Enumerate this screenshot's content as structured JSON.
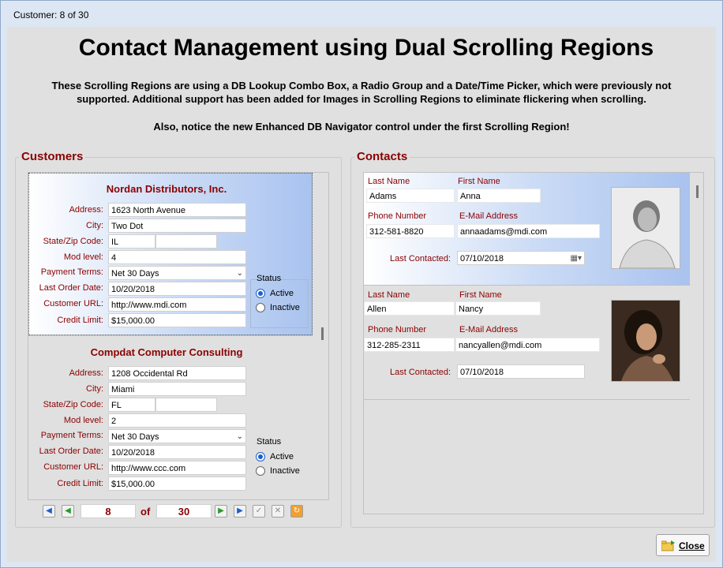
{
  "window": {
    "title": "Customer: 8 of 30"
  },
  "header": {
    "title": "Contact Management using Dual Scrolling Regions",
    "desc_line1": "These Scrolling Regions are using a DB Lookup Combo Box, a Radio Group and a Date/Time Picker, which were previously not",
    "desc_line2": "supported.  Additional support has been added for Images in Scrolling Regions to eliminate flickering when scrolling.",
    "desc_line3": "Also, notice the new Enhanced DB Navigator control under the first Scrolling Region!"
  },
  "customers": {
    "group_title": "Customers",
    "labels": {
      "address": "Address:",
      "city": "City:",
      "state_zip": "State/Zip Code:",
      "mod_level": "Mod level:",
      "payment_terms": "Payment Terms:",
      "last_order": "Last Order Date:",
      "url": "Customer URL:",
      "credit": "Credit Limit:",
      "status": "Status",
      "active": "Active",
      "inactive": "Inactive"
    },
    "records": [
      {
        "name": "Nordan Distributors, Inc.",
        "address": "1623 North Avenue",
        "city": "Two Dot",
        "state": "IL",
        "zip": "",
        "mod_level": "4",
        "payment_terms": "Net 30 Days",
        "last_order": "10/20/2018",
        "url": "http://www.mdi.com",
        "credit": "$15,000.00",
        "status": "Active"
      },
      {
        "name": "Compdat Computer Consulting",
        "address": "1208 Occidental Rd",
        "city": "Miami",
        "state": "FL",
        "zip": "",
        "mod_level": "2",
        "payment_terms": "Net 30 Days",
        "last_order": "10/20/2018",
        "url": "http://www.ccc.com",
        "credit": "$15,000.00",
        "status": "Active"
      }
    ],
    "navigator": {
      "current": "8",
      "of_label": "of",
      "total": "30"
    }
  },
  "contacts": {
    "group_title": "Contacts",
    "labels": {
      "last_name": "Last Name",
      "first_name": "First Name",
      "phone": "Phone Number",
      "email": "E-Mail Address",
      "last_contacted": "Last Contacted:"
    },
    "records": [
      {
        "last_name": "Adams",
        "first_name": "Anna",
        "phone": "312-581-8820",
        "email": "annaadams@mdi.com",
        "last_contacted": "07/10/2018"
      },
      {
        "last_name": "Allen",
        "first_name": "Nancy",
        "phone": "312-285-2311",
        "email": "nancyallen@mdi.com",
        "last_contacted": "07/10/2018"
      }
    ]
  },
  "footer": {
    "close_label": "Close"
  },
  "colors": {
    "label_red": "#8b0000",
    "selection_blue": "#a9c3ef",
    "radio_blue": "#1a5fcc"
  }
}
